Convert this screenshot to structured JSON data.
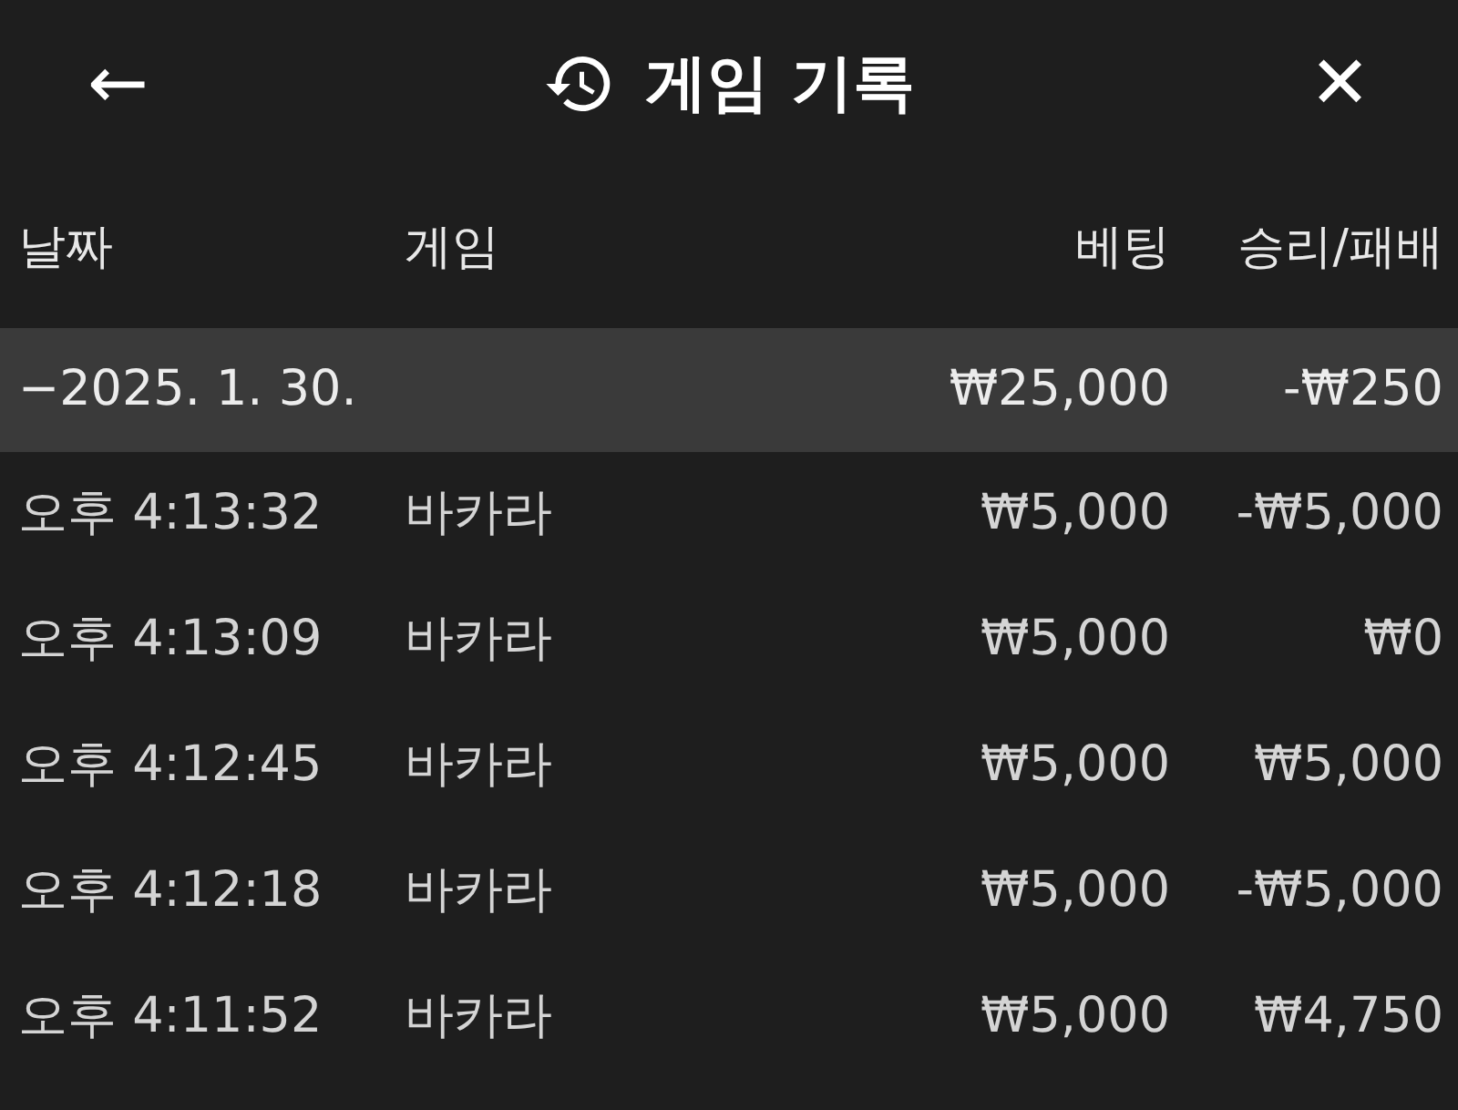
{
  "header": {
    "back": "←",
    "title": "게임 기록",
    "close": "✕"
  },
  "columns": [
    "날짜",
    "게임",
    "베팅",
    "승리/패배"
  ],
  "group": {
    "date": "−2025. 1. 30.",
    "bet": "₩25,000",
    "result": "-₩250"
  },
  "rows": [
    {
      "time": "오후 4:13:32",
      "game": "바카라",
      "bet": "₩5,000",
      "result": "-₩5,000"
    },
    {
      "time": "오후 4:13:09",
      "game": "바카라",
      "bet": "₩5,000",
      "result": "₩0"
    },
    {
      "time": "오후 4:12:45",
      "game": "바카라",
      "bet": "₩5,000",
      "result": "₩5,000"
    },
    {
      "time": "오후 4:12:18",
      "game": "바카라",
      "bet": "₩5,000",
      "result": "-₩5,000"
    },
    {
      "time": "오후 4:11:52",
      "game": "바카라",
      "bet": "₩5,000",
      "result": "₩4,750"
    }
  ]
}
